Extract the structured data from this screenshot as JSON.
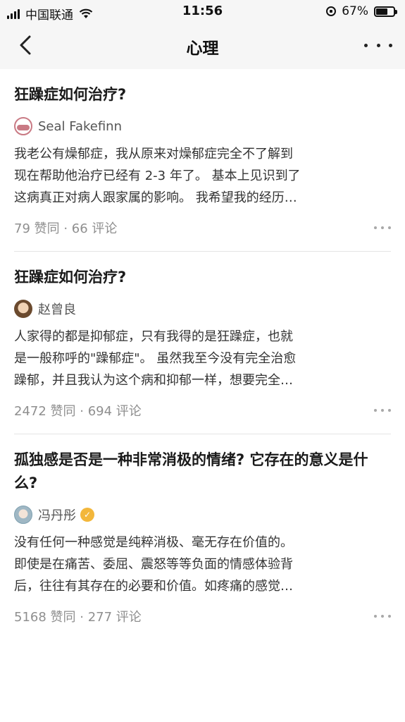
{
  "status_bar": {
    "carrier": "中国联通",
    "time": "11:56",
    "battery": "67%",
    "battery_level": 0.67
  },
  "nav": {
    "title": "心理"
  },
  "feed": [
    {
      "title": "狂躁症如何治疗?",
      "author": "Seal Fakefinn",
      "verified": false,
      "excerpt_lines": [
        "我老公有燥郁症，我从原来对燥郁症完全不了解到",
        "现在帮助他治疗已经有 2-3 年了。 基本上见识到了",
        "这病真正对病人跟家属的影响。 我希望我的经历…"
      ],
      "meta": "79 赞同 · 66 评论",
      "avatar_color": "#c97a84"
    },
    {
      "title": "狂躁症如何治疗?",
      "author": "赵曾良",
      "verified": false,
      "excerpt_lines": [
        "人家得的都是抑郁症，只有我得的是狂躁症，也就",
        "是一般称呼的\"躁郁症\"。 虽然我至今没有完全治愈",
        "躁郁，并且我认为这个病和抑郁一样，想要完全…"
      ],
      "meta": "2472 赞同 · 694 评论",
      "avatar_color": "#8b6a4a"
    },
    {
      "title": "孤独感是否是一种非常消极的情绪? 它存在的意义是什么?",
      "author": "冯丹彤",
      "verified": true,
      "excerpt_lines": [
        "没有任何一种感觉是纯粹消极、毫无存在价值的。",
        "即使是在痛苦、委屈、震怒等等负面的情感体验背",
        "后，往往有其存在的必要和价值。如疼痛的感觉…"
      ],
      "meta": "5168 赞同 · 277 评论",
      "avatar_color": "#9fb7c4"
    }
  ]
}
